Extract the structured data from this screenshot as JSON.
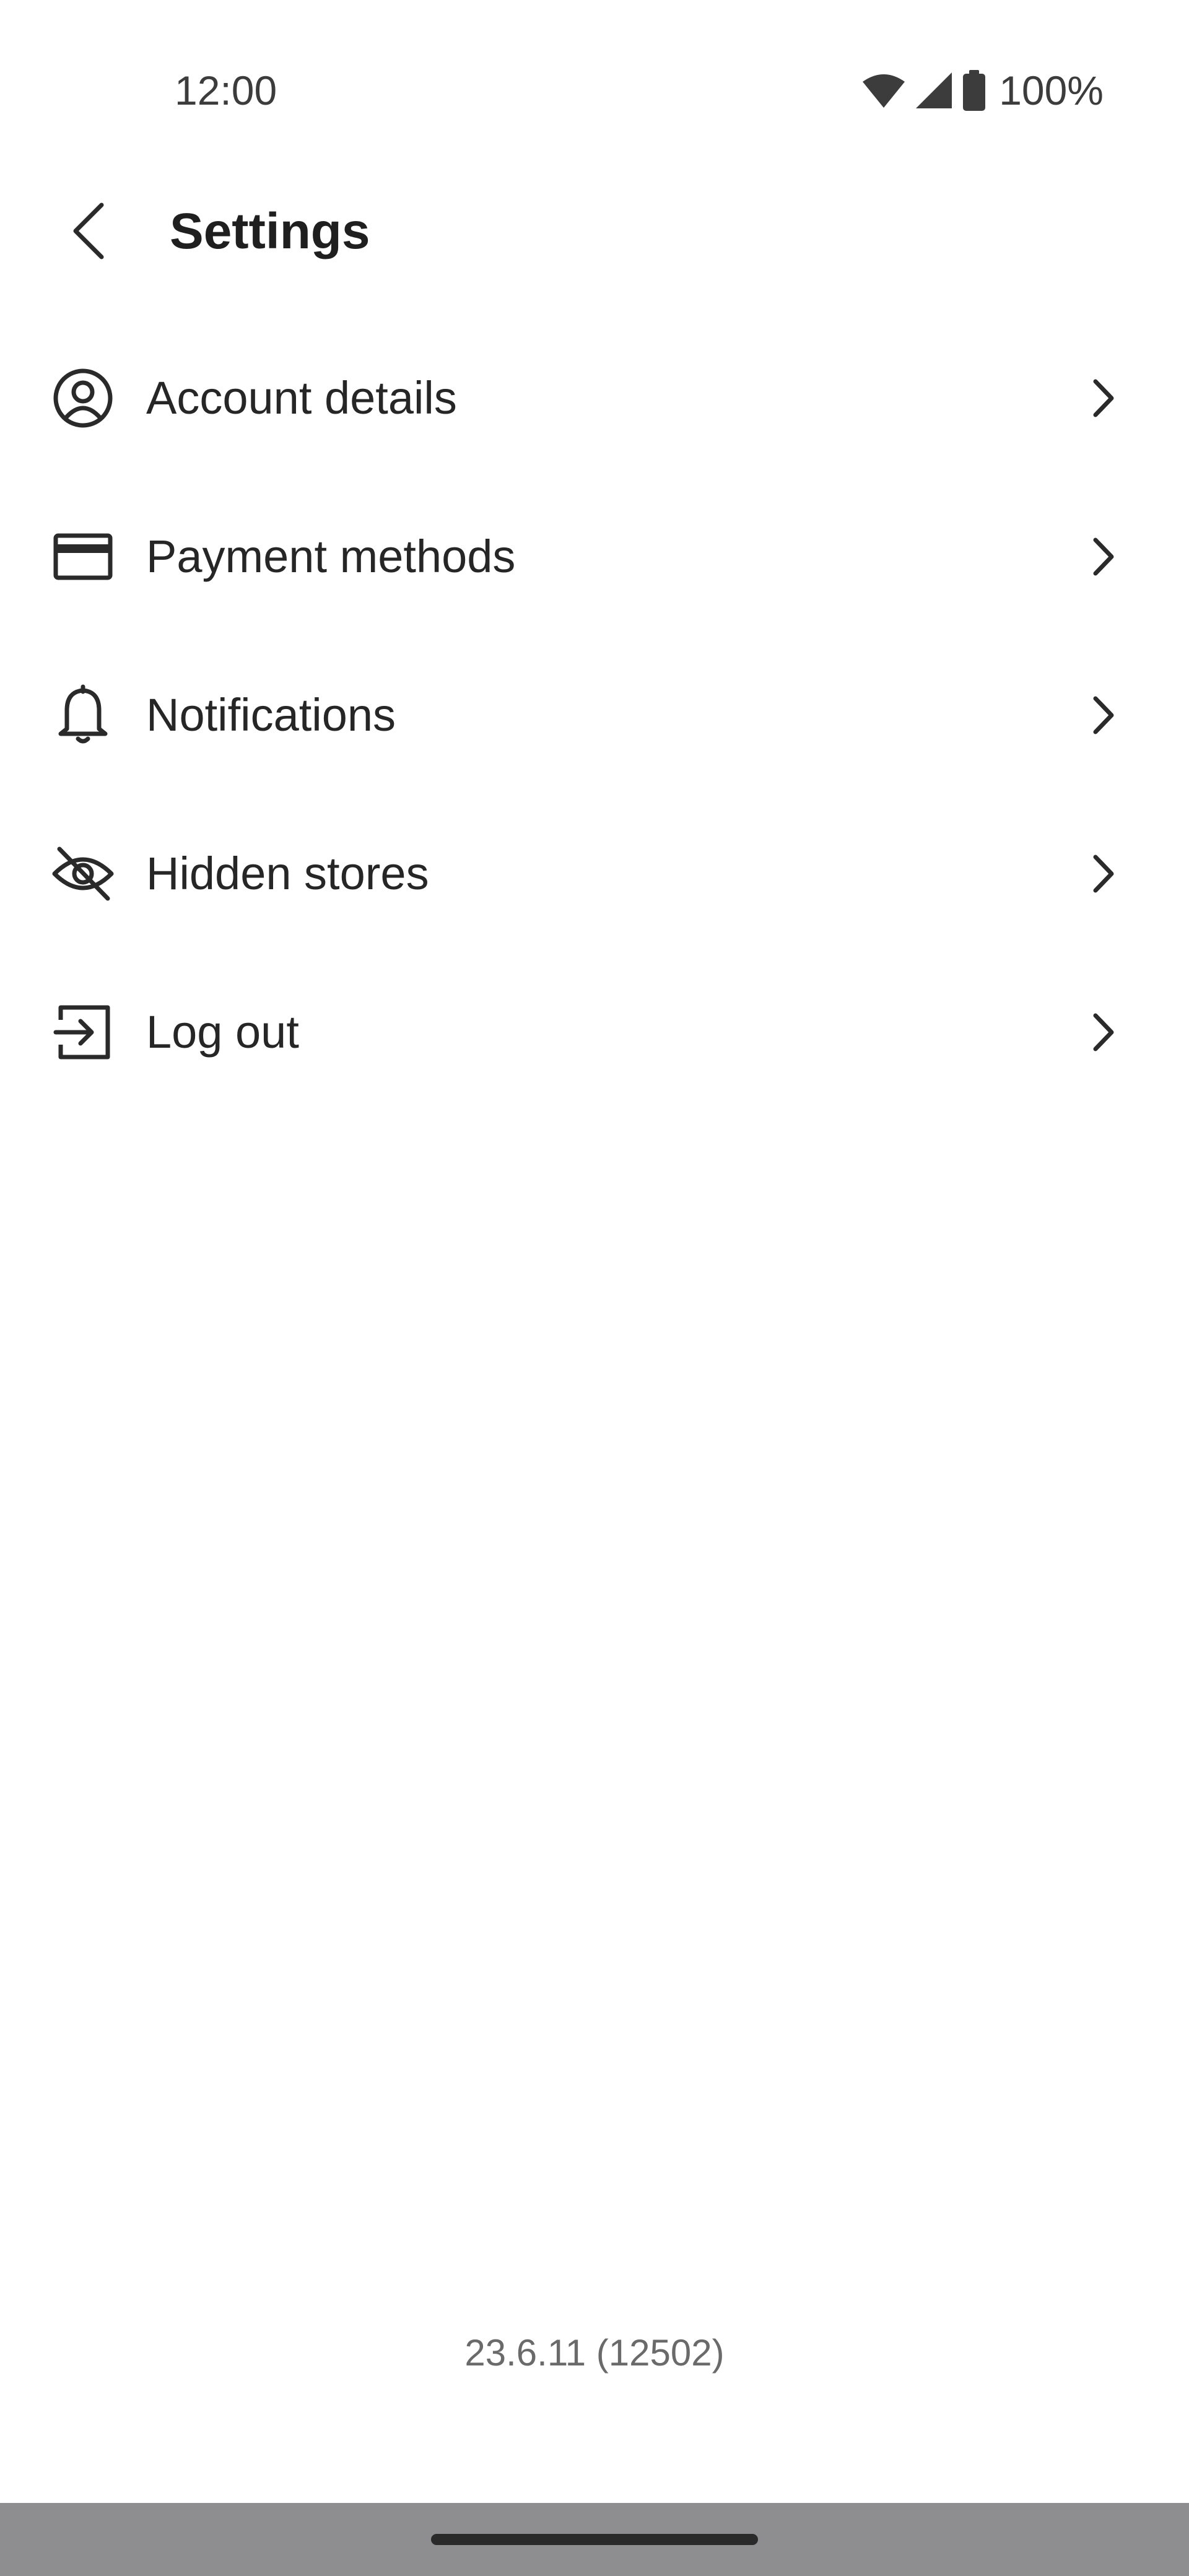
{
  "status_bar": {
    "time": "12:00",
    "battery_percent": "100%",
    "icons": [
      "wifi-icon",
      "cellular-signal-icon",
      "battery-icon"
    ]
  },
  "header": {
    "title": "Settings",
    "back_icon": "chevron-left-icon"
  },
  "menu": {
    "items": [
      {
        "label": "Account details",
        "icon": "account-circle-icon"
      },
      {
        "label": "Payment methods",
        "icon": "credit-card-icon"
      },
      {
        "label": "Notifications",
        "icon": "bell-icon"
      },
      {
        "label": "Hidden stores",
        "icon": "eye-off-icon"
      },
      {
        "label": "Log out",
        "icon": "logout-icon"
      }
    ],
    "chevron_icon": "chevron-right-icon"
  },
  "footer": {
    "version": "23.6.11 (12502)"
  },
  "colors": {
    "background": "#ffffff",
    "text_primary": "#1f1f1f",
    "text_secondary": "#6a6a6a",
    "nav_bar": "#8e8e90"
  }
}
